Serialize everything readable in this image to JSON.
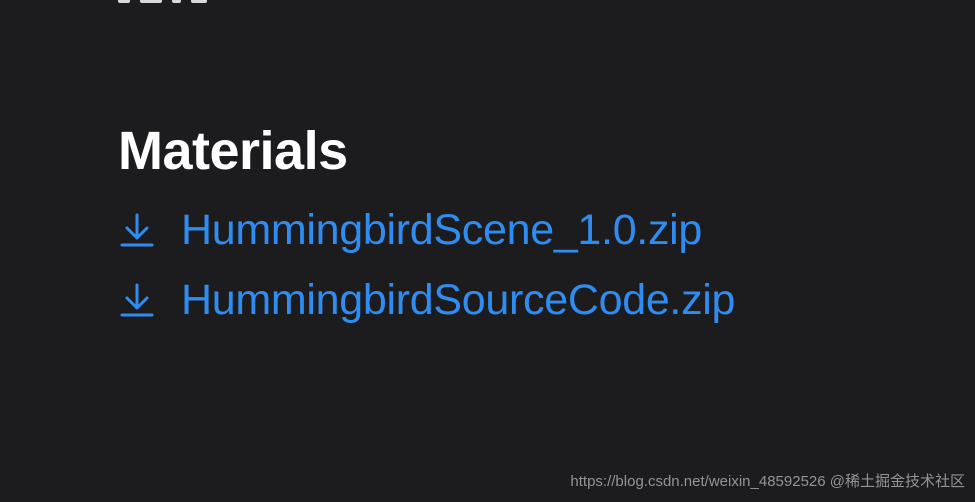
{
  "materials": {
    "heading": "Materials",
    "files": [
      {
        "name": "HummingbirdScene_1.0.zip",
        "icon": "download-icon"
      },
      {
        "name": "HummingbirdSourceCode.zip",
        "icon": "download-icon"
      }
    ],
    "link_color": "#2f8cf0"
  },
  "watermark": {
    "text": "https://blog.csdn.net/weixin_48592526  @稀土掘金技术社区"
  }
}
